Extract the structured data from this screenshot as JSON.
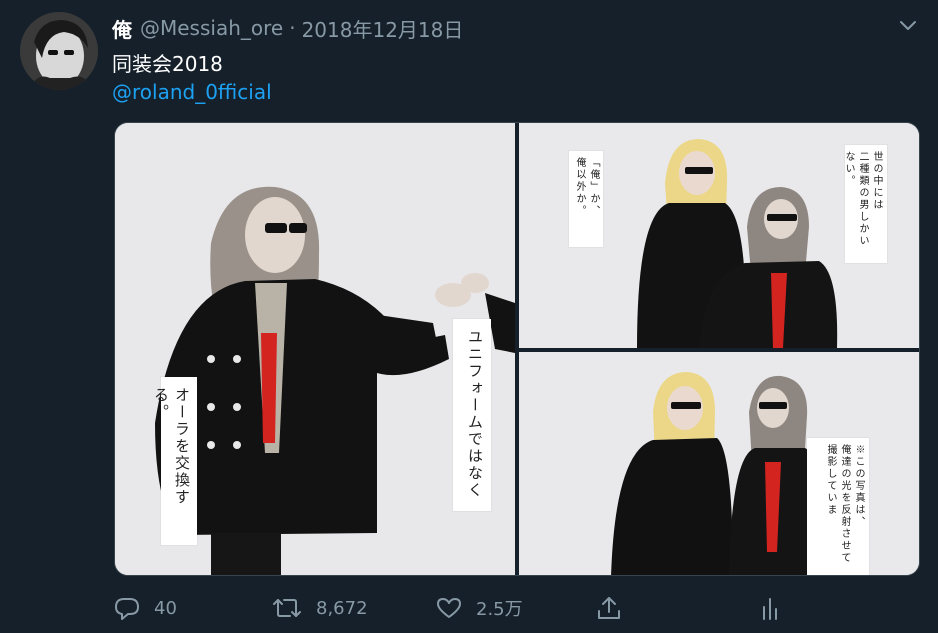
{
  "tweet": {
    "display_name": "俺",
    "handle": "@Messiah_ore",
    "separator": "·",
    "date": "2018年12月18日",
    "text_line1": "同装会2018",
    "text_line2": "@roland_0fficial"
  },
  "media": {
    "left_card_top": "ユニフォームではなく",
    "left_card_bottom": [
      "オーラを交換する。"
    ],
    "tr_card_left": [
      "「俺」か、",
      "俺以外か。"
    ],
    "tr_card_right": [
      "世の中には",
      "二種類の男しかいない。"
    ],
    "br_card_right": [
      "※この写真は、",
      "俺達の光を反射させて",
      "撮影していま"
    ]
  },
  "actions": {
    "reply_count": "40",
    "retweet_count": "8,672",
    "like_count": "2.5万"
  },
  "icons": {
    "caret": "chevron-down-icon",
    "reply": "reply-icon",
    "retweet": "retweet-icon",
    "like": "heart-icon",
    "share": "share-icon",
    "analytics": "analytics-icon"
  },
  "colors": {
    "background": "#15202b",
    "muted": "#8899a6",
    "link": "#1da1f2",
    "text": "#ffffff"
  }
}
